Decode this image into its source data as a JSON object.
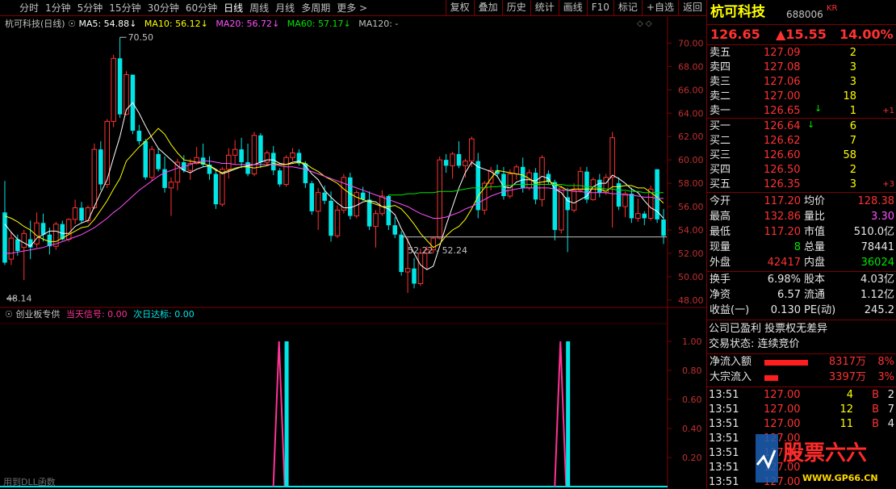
{
  "toolbar": {
    "periods": [
      "分时",
      "1分钟",
      "5分钟",
      "15分钟",
      "30分钟",
      "60分钟",
      "日线",
      "周线",
      "月线",
      "多周期",
      "更多 >"
    ],
    "active_index": 6,
    "right_buttons": [
      "复权",
      "叠加",
      "历史",
      "统计",
      "画线",
      "F10",
      "标记",
      "+自选",
      "返回"
    ]
  },
  "chart_header": {
    "name": "杭可科技(日线)",
    "ma5": "MA5: 54.88",
    "ma10": "MA10: 56.12",
    "ma20": "MA20: 56.72",
    "ma60": "MA60: 57.17",
    "ma120": "MA120: -",
    "colors": {
      "ma5": "#ffffff",
      "ma10": "#ffff00",
      "ma20": "#ff50ff",
      "ma60": "#00e600",
      "ma120": "#c0c0c0"
    }
  },
  "price_axis": [
    "70.00",
    "68.00",
    "66.00",
    "64.00",
    "62.00",
    "60.00",
    "58.00",
    "56.00",
    "54.00",
    "52.00",
    "50.00",
    "48.00"
  ],
  "annotations": {
    "high": "70.50",
    "low": "48.14",
    "range_label": "52.22 - 52.24"
  },
  "indicator": {
    "name": "创业板专供",
    "signal1": "当天信号: 0.00",
    "signal2": "次日达标: 0.00",
    "axis": [
      "1.00",
      "0.80",
      "0.60",
      "0.40",
      "0.20"
    ],
    "footer": "用到DLL函数"
  },
  "chart_data": {
    "type": "candlestick",
    "ylim": [
      47.5,
      71
    ],
    "candles": [
      [
        55.5,
        58.2,
        51.0,
        51.2
      ],
      [
        51.5,
        53.8,
        51.0,
        53.3
      ],
      [
        53.2,
        53.6,
        51.8,
        52.2
      ],
      [
        52.5,
        54.0,
        49.7,
        53.7
      ],
      [
        53.2,
        54.8,
        51.5,
        52.5
      ],
      [
        52.8,
        55.5,
        52.5,
        54.6
      ],
      [
        54.6,
        55.4,
        53.0,
        53.6
      ],
      [
        53.6,
        54.2,
        51.9,
        52.6
      ],
      [
        52.6,
        54.7,
        52.3,
        54.5
      ],
      [
        54.5,
        54.8,
        53.1,
        53.2
      ],
      [
        53.2,
        55.0,
        53.0,
        54.9
      ],
      [
        54.9,
        56.6,
        54.5,
        55.9
      ],
      [
        55.9,
        56.4,
        54.6,
        54.8
      ],
      [
        54.8,
        56.1,
        54.6,
        55.9
      ],
      [
        55.9,
        61.4,
        55.8,
        60.9
      ],
      [
        60.9,
        61.6,
        57.4,
        57.9
      ],
      [
        57.9,
        63.5,
        57.6,
        63.3
      ],
      [
        63.3,
        69.0,
        62.8,
        68.7
      ],
      [
        68.7,
        70.5,
        63.6,
        63.9
      ],
      [
        63.9,
        67.6,
        63.8,
        67.3
      ],
      [
        67.3,
        67.3,
        62.2,
        62.5
      ],
      [
        62.5,
        63.0,
        61.3,
        61.6
      ],
      [
        61.6,
        61.8,
        58.3,
        58.5
      ],
      [
        58.5,
        61.2,
        58.2,
        60.9
      ],
      [
        60.5,
        61.0,
        59.0,
        59.2
      ],
      [
        59.2,
        60.3,
        57.2,
        57.6
      ],
      [
        57.6,
        58.5,
        55.2,
        58.1
      ],
      [
        58.1,
        60.1,
        57.4,
        59.8
      ],
      [
        59.8,
        60.4,
        58.9,
        59.1
      ],
      [
        59.1,
        60.1,
        58.3,
        59.7
      ],
      [
        59.7,
        61.1,
        59.6,
        60.2
      ],
      [
        60.2,
        61.4,
        59.4,
        59.6
      ],
      [
        59.6,
        60.3,
        58.3,
        58.8
      ],
      [
        58.8,
        59.2,
        55.8,
        56.2
      ],
      [
        56.2,
        59.4,
        56.0,
        59.2
      ],
      [
        59.2,
        61.0,
        58.4,
        60.4
      ],
      [
        60.4,
        61.7,
        59.6,
        60.9
      ],
      [
        60.9,
        61.9,
        59.3,
        59.8
      ],
      [
        59.8,
        61.4,
        58.6,
        58.8
      ],
      [
        58.8,
        62.4,
        58.6,
        62.1
      ],
      [
        62.1,
        62.3,
        59.3,
        59.8
      ],
      [
        59.8,
        60.8,
        59.5,
        60.6
      ],
      [
        60.6,
        61.2,
        58.7,
        59.1
      ],
      [
        59.1,
        59.3,
        57.7,
        57.9
      ],
      [
        57.9,
        60.4,
        57.7,
        60.2
      ],
      [
        60.2,
        61.0,
        59.9,
        60.6
      ],
      [
        60.6,
        60.9,
        59.5,
        59.7
      ],
      [
        59.7,
        59.9,
        57.6,
        58.0
      ],
      [
        58.0,
        58.2,
        55.3,
        55.6
      ],
      [
        55.6,
        57.6,
        54.0,
        57.2
      ],
      [
        57.2,
        57.8,
        56.2,
        56.5
      ],
      [
        56.5,
        57.3,
        53.0,
        53.5
      ],
      [
        53.5,
        56.1,
        53.3,
        55.7
      ],
      [
        55.7,
        58.8,
        55.4,
        58.5
      ],
      [
        58.5,
        58.9,
        54.9,
        55.2
      ],
      [
        55.2,
        57.4,
        55.0,
        57.2
      ],
      [
        57.2,
        57.7,
        56.5,
        56.6
      ],
      [
        56.6,
        57.3,
        54.0,
        54.3
      ],
      [
        54.3,
        55.7,
        52.5,
        55.4
      ],
      [
        55.4,
        57.4,
        55.2,
        56.9
      ],
      [
        56.9,
        57.0,
        54.0,
        54.4
      ],
      [
        54.4,
        55.1,
        53.3,
        53.6
      ],
      [
        53.6,
        53.9,
        50.1,
        50.4
      ],
      [
        50.4,
        53.3,
        48.6,
        50.7
      ],
      [
        50.7,
        51.6,
        49.0,
        49.4
      ],
      [
        49.4,
        52.4,
        49.2,
        52.0
      ],
      [
        52.0,
        52.6,
        50.6,
        52.3
      ],
      [
        52.3,
        53.4,
        52.0,
        53.3
      ],
      [
        53.3,
        60.3,
        53.2,
        60.0
      ],
      [
        60.0,
        60.5,
        58.9,
        59.5
      ],
      [
        59.5,
        60.7,
        58.4,
        60.5
      ],
      [
        60.5,
        61.6,
        59.3,
        59.5
      ],
      [
        59.5,
        60.1,
        58.5,
        59.9
      ],
      [
        59.9,
        62.0,
        59.4,
        61.8
      ],
      [
        59.9,
        60.6,
        55.0,
        55.7
      ],
      [
        55.7,
        58.2,
        55.3,
        58.0
      ],
      [
        58.0,
        59.4,
        57.4,
        59.1
      ],
      [
        59.1,
        59.6,
        58.5,
        58.8
      ],
      [
        58.8,
        59.4,
        56.6,
        56.9
      ],
      [
        56.9,
        59.2,
        56.7,
        58.8
      ],
      [
        58.8,
        59.6,
        58.3,
        59.4
      ],
      [
        59.4,
        60.2,
        57.2,
        57.6
      ],
      [
        57.6,
        59.2,
        57.4,
        58.9
      ],
      [
        58.9,
        59.3,
        56.2,
        56.6
      ],
      [
        56.6,
        60.4,
        56.0,
        60.2
      ],
      [
        58.8,
        59.1,
        57.9,
        58.1
      ],
      [
        58.1,
        58.3,
        53.1,
        54.0
      ],
      [
        54.0,
        57.8,
        53.7,
        57.6
      ],
      [
        56.8,
        57.6,
        52.1,
        55.7
      ],
      [
        55.7,
        58.0,
        55.5,
        57.4
      ],
      [
        57.4,
        59.4,
        57.2,
        59.0
      ],
      [
        59.0,
        59.4,
        56.3,
        56.6
      ],
      [
        56.6,
        58.5,
        56.5,
        58.3
      ],
      [
        58.3,
        58.8,
        56.8,
        57.2
      ],
      [
        57.2,
        58.8,
        57.0,
        58.5
      ],
      [
        58.5,
        62.4,
        54.2,
        61.9
      ],
      [
        58.0,
        58.5,
        55.7,
        56.0
      ],
      [
        56.0,
        57.3,
        55.1,
        57.1
      ],
      [
        57.1,
        57.6,
        54.6,
        55.0
      ],
      [
        55.0,
        56.7,
        54.7,
        55.4
      ],
      [
        55.4,
        55.6,
        54.4,
        55.0
      ],
      [
        55.0,
        57.8,
        54.8,
        57.5
      ],
      [
        59.2,
        59.2,
        54.6,
        54.9
      ],
      [
        54.9,
        55.8,
        52.8,
        53.5
      ]
    ],
    "ma_series": [
      {
        "name": "MA5",
        "values": [
          54.5,
          53.8,
          53.2,
          52.9,
          52.6,
          53.3,
          53.6,
          53.9,
          53.9,
          53.7,
          53.7,
          54.3,
          54.6,
          54.8,
          56.0,
          57.2,
          58.3,
          60.2,
          62.0,
          64.3,
          64.9,
          64.0,
          62.9,
          61.9,
          61.0,
          60.5,
          60.0,
          59.5,
          59.1,
          58.9,
          59.2,
          59.4,
          59.5,
          59.2,
          58.8,
          59.0,
          59.2,
          59.4,
          59.5,
          59.6,
          59.8,
          60.0,
          60.0,
          59.7,
          59.6,
          59.8,
          59.9,
          59.5,
          58.8,
          58.3,
          57.4,
          56.8,
          56.3,
          55.9,
          55.9,
          56.1,
          56.4,
          56.5,
          56.4,
          56.0,
          55.8,
          55.3,
          54.1,
          53.1,
          52.0,
          51.0,
          50.6,
          50.9,
          52.6,
          54.4,
          56.0,
          57.6,
          58.9,
          59.8,
          59.4,
          59.2,
          59.0,
          58.6,
          57.7,
          57.6,
          58.1,
          58.3,
          58.3,
          58.2,
          58.6,
          58.4,
          57.5,
          57.2,
          56.5,
          56.3,
          56.6,
          56.9,
          57.7,
          58.0,
          58.0,
          58.7,
          58.4,
          58.0,
          57.5,
          57.2,
          56.5,
          55.9,
          55.6,
          55.0
        ],
        "color": "#ffffff"
      },
      {
        "name": "MA10",
        "values": [
          55.2,
          55.0,
          54.7,
          54.3,
          54.0,
          53.5,
          53.2,
          53.0,
          53.0,
          53.3,
          53.6,
          53.9,
          54.2,
          54.3,
          54.9,
          55.7,
          56.5,
          57.5,
          58.4,
          59.9,
          60.5,
          61.1,
          61.6,
          62.1,
          62.7,
          62.2,
          61.3,
          60.6,
          60.0,
          59.9,
          59.8,
          59.7,
          59.5,
          59.1,
          58.9,
          59.1,
          59.3,
          59.4,
          59.4,
          59.3,
          59.4,
          59.5,
          59.7,
          59.6,
          59.6,
          59.7,
          59.8,
          59.7,
          59.3,
          59.0,
          58.6,
          58.3,
          58.0,
          57.5,
          57.1,
          56.8,
          56.6,
          56.4,
          56.2,
          56.0,
          56.0,
          56.1,
          55.8,
          55.2,
          54.5,
          53.7,
          53.1,
          52.5,
          52.8,
          53.5,
          54.0,
          54.3,
          54.9,
          55.8,
          56.9,
          57.6,
          58.4,
          59.1,
          59.0,
          58.9,
          58.8,
          58.7,
          58.4,
          58.0,
          58.1,
          58.2,
          57.9,
          57.7,
          57.4,
          57.5,
          57.5,
          57.5,
          57.5,
          57.5,
          57.3,
          57.7,
          57.7,
          57.8,
          57.8,
          57.6,
          57.6,
          57.2,
          56.8,
          56.3
        ],
        "color": "#ffff00"
      },
      {
        "name": "MA20",
        "values": [
          52.0,
          52.0,
          52.1,
          52.2,
          52.3,
          52.4,
          52.5,
          52.7,
          52.8,
          53.0,
          53.2,
          53.4,
          53.6,
          53.9,
          54.2,
          54.6,
          55.0,
          55.5,
          55.9,
          56.4,
          56.9,
          57.4,
          57.8,
          58.2,
          58.6,
          58.9,
          59.1,
          59.3,
          59.4,
          59.6,
          59.8,
          59.9,
          59.9,
          59.8,
          59.7,
          59.7,
          59.6,
          59.6,
          59.6,
          59.6,
          59.6,
          59.6,
          59.6,
          59.5,
          59.4,
          59.4,
          59.3,
          59.2,
          59.0,
          58.8,
          58.6,
          58.4,
          58.2,
          58.0,
          57.8,
          57.6,
          57.4,
          57.2,
          57.0,
          56.8,
          56.6,
          56.4,
          56.2,
          56.0,
          55.7,
          55.4,
          55.2,
          55.0,
          55.0,
          55.1,
          55.3,
          55.5,
          55.8,
          56.0,
          56.3,
          56.6,
          56.9,
          57.1,
          57.3,
          57.4,
          57.5,
          57.6,
          57.6,
          57.6,
          57.6,
          57.6,
          57.5,
          57.4,
          57.4,
          57.3,
          57.3,
          57.2,
          57.2,
          57.2,
          57.2,
          57.1,
          57.1,
          57.0,
          57.0,
          56.9,
          56.8,
          56.8,
          56.7,
          56.7
        ],
        "color": "#ff50ff"
      },
      {
        "name": "MA60",
        "values": [
          null,
          null,
          null,
          null,
          null,
          null,
          null,
          null,
          null,
          null,
          null,
          null,
          null,
          null,
          null,
          null,
          null,
          null,
          null,
          null,
          null,
          null,
          null,
          null,
          null,
          null,
          null,
          null,
          null,
          null,
          null,
          null,
          null,
          null,
          null,
          null,
          null,
          null,
          null,
          null,
          null,
          null,
          null,
          null,
          null,
          null,
          null,
          null,
          null,
          null,
          null,
          null,
          null,
          null,
          null,
          null,
          null,
          null,
          null,
          null,
          57.0,
          57.0,
          57.0,
          57.1,
          57.1,
          57.2,
          57.2,
          57.2,
          57.3,
          57.3,
          57.3,
          57.4,
          57.5,
          57.6,
          57.6,
          57.6,
          57.7,
          57.7,
          57.8,
          57.8,
          57.9,
          57.9,
          57.9,
          57.9,
          57.9,
          57.9,
          57.9,
          57.9,
          57.8,
          57.8,
          57.8,
          57.7,
          57.7,
          57.6,
          57.5,
          57.5,
          57.4,
          57.4,
          57.3,
          57.3,
          57.2,
          57.2,
          57.2,
          57.2
        ],
        "color": "#00e600"
      }
    ],
    "indicator_bars": [
      {
        "index": 44,
        "value": 1.0
      },
      {
        "index": 88,
        "value": 1.0
      }
    ],
    "indicator_spikes": [
      {
        "index": 43,
        "value": 1.0
      },
      {
        "index": 87,
        "value": 1.0
      }
    ]
  },
  "quote": {
    "name": "杭可科技",
    "code": "688006",
    "badge": "KR",
    "price": "126.65",
    "change": "▲15.55",
    "pct": "14.00%",
    "asks": [
      {
        "label": "卖五",
        "price": "127.09",
        "vol": "2",
        "extra": ""
      },
      {
        "label": "卖四",
        "price": "127.08",
        "vol": "3",
        "extra": ""
      },
      {
        "label": "卖三",
        "price": "127.06",
        "vol": "3",
        "extra": ""
      },
      {
        "label": "卖二",
        "price": "127.00",
        "vol": "18",
        "extra": ""
      },
      {
        "label": "卖一",
        "price": "126.65",
        "vol": "1",
        "extra": "+1"
      }
    ],
    "bids": [
      {
        "label": "买一",
        "price": "126.64",
        "vol": "6",
        "extra": ""
      },
      {
        "label": "买二",
        "price": "126.62",
        "vol": "7",
        "extra": ""
      },
      {
        "label": "买三",
        "price": "126.60",
        "vol": "58",
        "extra": ""
      },
      {
        "label": "买四",
        "price": "126.50",
        "vol": "2",
        "extra": ""
      },
      {
        "label": "买五",
        "price": "126.35",
        "vol": "3",
        "extra": "+3"
      }
    ],
    "stats1": [
      {
        "l1": "今开",
        "v1": "117.20",
        "l2": "均价",
        "v2": "128.38"
      },
      {
        "l1": "最高",
        "v1": "132.86",
        "l2": "量比",
        "v2": "3.30"
      },
      {
        "l1": "最低",
        "v1": "117.20",
        "l2": "市值",
        "v2": "510.0亿"
      },
      {
        "l1": "现量",
        "v1": "8",
        "l2": "总量",
        "v2": "78441"
      },
      {
        "l1": "外盘",
        "v1": "42417",
        "l2": "内盘",
        "v2": "36024"
      }
    ],
    "stats2": [
      {
        "l1": "换手",
        "v1": "6.98%",
        "l2": "股本",
        "v2": "4.03亿"
      },
      {
        "l1": "净资",
        "v1": "6.57",
        "l2": "流通",
        "v2": "1.12亿"
      },
      {
        "l1": "收益(一)",
        "v1": "0.130",
        "l2": "PE(动)",
        "v2": "245.2"
      }
    ],
    "company_line": "公司已盈利 投票权无差异",
    "trade_status": "交易状态: 连续竞价",
    "flows": [
      {
        "label": "净流入额",
        "bar": 1.0,
        "value": "8317万",
        "pct": "8%"
      },
      {
        "label": "大宗流入",
        "bar": 0.32,
        "value": "3397万",
        "pct": "3%"
      }
    ],
    "ticks": [
      {
        "time": "13:51",
        "price": "127.00",
        "vol": "4",
        "side": "B",
        "n": "2"
      },
      {
        "time": "13:51",
        "price": "127.00",
        "vol": "12",
        "side": "B",
        "n": "7"
      },
      {
        "time": "13:51",
        "price": "127.00",
        "vol": "11",
        "side": "B",
        "n": "4"
      },
      {
        "time": "13:51",
        "price": "127.00",
        "vol": "",
        "side": "",
        "n": ""
      },
      {
        "time": "13:51",
        "price": "127.00",
        "vol": "",
        "side": "",
        "n": ""
      },
      {
        "time": "13:51",
        "price": "127.00",
        "vol": "",
        "side": "",
        "n": ""
      },
      {
        "time": "13:51",
        "price": "127.00",
        "vol": "",
        "side": "",
        "n": ""
      }
    ],
    "watermark": "股票六六",
    "watermark_url": "WWW.GP66.CN"
  }
}
